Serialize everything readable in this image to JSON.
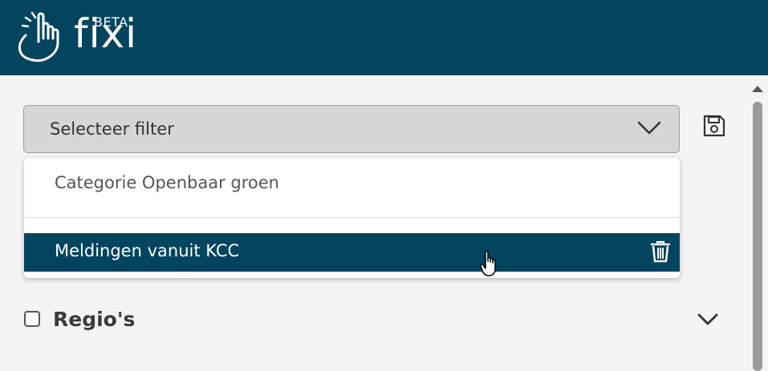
{
  "header": {
    "brand": "fixi",
    "badge": "BETA",
    "background_color": "#03445f",
    "logo_icon": "hand-pointer-icon"
  },
  "filter": {
    "select_label": "Selecteer filter",
    "chevron_icon": "chevron-down-icon",
    "save_icon": "save-icon",
    "options": [
      {
        "label": "Categorie Openbaar groen",
        "highlighted": false
      },
      {
        "label": "Meldingen vanuit KCC",
        "highlighted": true,
        "action_icon": "trash-icon"
      }
    ]
  },
  "regio": {
    "label": "Regio's",
    "checked": false,
    "chevron_icon": "chevron-down-icon"
  },
  "colors": {
    "accent": "#03445f",
    "select_bg": "#d6d6d6",
    "page_bg": "#f4f4f4"
  }
}
